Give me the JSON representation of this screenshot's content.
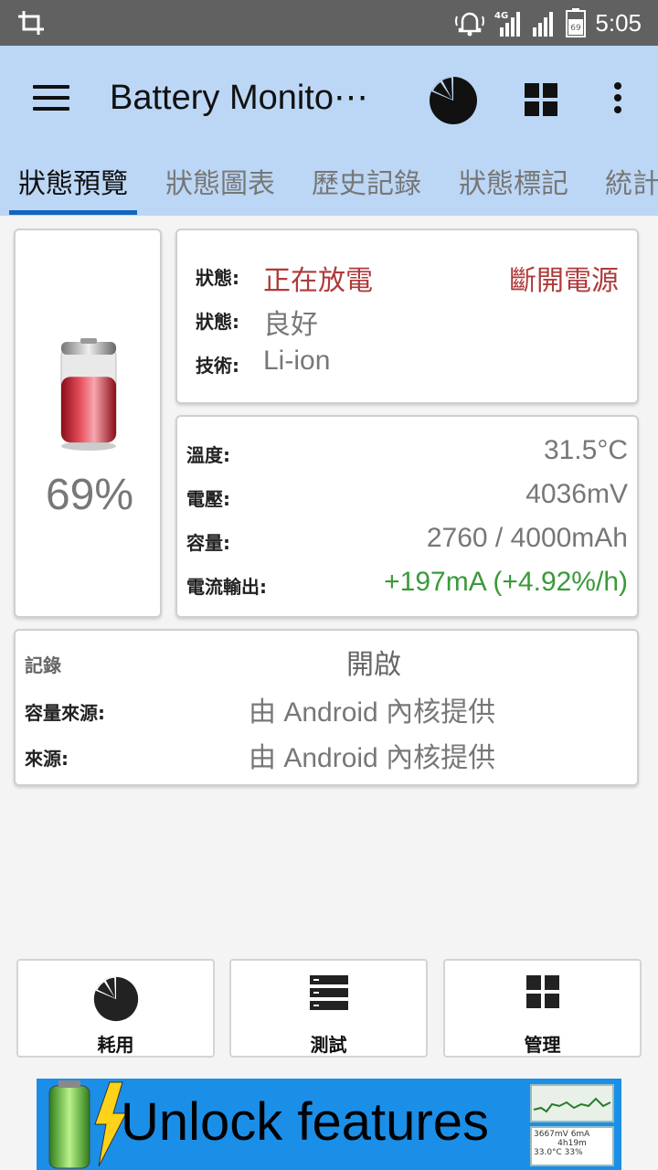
{
  "status_bar": {
    "time": "5:05",
    "network": "4G",
    "battery_level": "69",
    "icons": [
      "crop-icon",
      "alarm-icon",
      "signal-icon",
      "signal-icon",
      "battery-icon"
    ]
  },
  "app_bar": {
    "title": "Battery Monito⋯",
    "actions": [
      "pie-chart-icon",
      "grid-icon",
      "more-vert-icon"
    ]
  },
  "tabs": [
    {
      "label": "狀態預覽",
      "active": true
    },
    {
      "label": "狀態圖表",
      "active": false
    },
    {
      "label": "歷史記錄",
      "active": false
    },
    {
      "label": "狀態標記",
      "active": false
    },
    {
      "label": "統計",
      "active": false
    }
  ],
  "battery": {
    "percent_label": "69%",
    "level_fraction": 0.69
  },
  "status": {
    "rows": [
      {
        "label": "狀態:",
        "value": "正在放電",
        "extra": "斷開電源"
      },
      {
        "label": "狀態:",
        "value": "良好"
      },
      {
        "label": "技術:",
        "value": "Li-ion"
      }
    ]
  },
  "metrics": {
    "rows": [
      {
        "label": "溫度:",
        "value": "31.5°C"
      },
      {
        "label": "電壓:",
        "value": "4036mV"
      },
      {
        "label": "容量:",
        "value": "2760 / 4000mAh"
      },
      {
        "label": "電流輸出:",
        "value": "+197mA (+4.92%/h)"
      }
    ]
  },
  "log": {
    "header_label": "記錄",
    "header_value": "開啟",
    "rows": [
      {
        "label": "容量來源:",
        "value": "由 Android 內核提供"
      },
      {
        "label": "來源:",
        "value": "由 Android 內核提供"
      }
    ]
  },
  "buttons": [
    {
      "label": "耗用",
      "icon": "pie-chart-icon"
    },
    {
      "label": "測試",
      "icon": "server-list-icon"
    },
    {
      "label": "管理",
      "icon": "grid-icon"
    }
  ],
  "banner": {
    "text": "Unlock features",
    "thumb_top": "3667mV   6mA",
    "thumb_mid": "4h19m",
    "thumb_bottom": "33.0°C   33%"
  },
  "colors": {
    "app_bar": "#bcd7f5",
    "status_bar": "#616161",
    "tab_indicator": "#1565c0",
    "discharging": "#b03a3a",
    "current_positive": "#3a9a3a",
    "banner": "#1b8fe8"
  }
}
